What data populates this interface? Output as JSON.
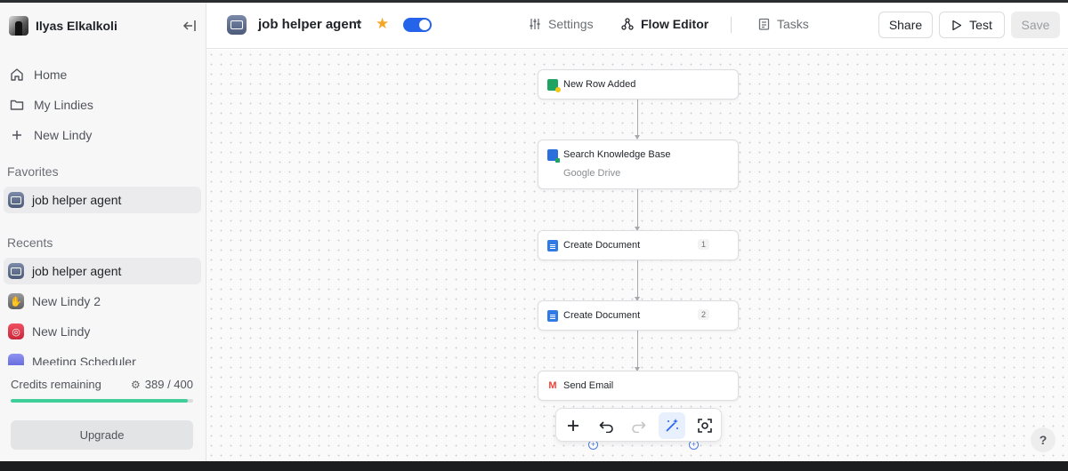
{
  "user": {
    "name": "Ilyas Elkalkoli"
  },
  "sidebar": {
    "nav": [
      {
        "label": "Home",
        "icon": "home-icon"
      },
      {
        "label": "My Lindies",
        "icon": "folder-icon"
      },
      {
        "label": "New Lindy",
        "icon": "plus-icon"
      }
    ],
    "favorites_label": "Favorites",
    "favorites": [
      {
        "label": "job helper agent",
        "icon": "robot-icon"
      }
    ],
    "recents_label": "Recents",
    "recents": [
      {
        "label": "job helper agent",
        "icon": "robot-icon"
      },
      {
        "label": "New Lindy 2",
        "icon": "hand-icon"
      },
      {
        "label": "New Lindy",
        "icon": "fingerprint-icon"
      },
      {
        "label": "Meeting Scheduler",
        "icon": "calendar-icon"
      }
    ],
    "credits": {
      "label": "Credits remaining",
      "value": "389 / 400",
      "used_fraction": 0.9725
    },
    "upgrade_label": "Upgrade"
  },
  "header": {
    "agent_name": "job helper agent",
    "favorite": true,
    "enabled": true,
    "tabs": [
      {
        "label": "Settings",
        "icon": "sliders-icon"
      },
      {
        "label": "Flow Editor",
        "icon": "flow-icon"
      },
      {
        "label": "Tasks",
        "icon": "clipboard-icon"
      }
    ],
    "share_label": "Share",
    "test_label": "Test",
    "save_label": "Save"
  },
  "flow": {
    "nodes": [
      {
        "title": "New Row Added",
        "subtitle": "",
        "step": "",
        "icon": "google-sheets-icon"
      },
      {
        "title": "Search Knowledge Base",
        "subtitle": "Google Drive",
        "step": "",
        "icon": "knowledge-base-icon"
      },
      {
        "title": "Create Document",
        "subtitle": "",
        "step": "1",
        "icon": "google-docs-icon"
      },
      {
        "title": "Create Document",
        "subtitle": "",
        "step": "2",
        "icon": "google-docs-icon"
      },
      {
        "title": "Send Email",
        "subtitle": "",
        "step": "",
        "icon": "gmail-icon"
      }
    ]
  },
  "colors": {
    "accent": "#2563eb",
    "credits_bar": "#3ecf9a",
    "star": "#f5a623"
  },
  "help_label": "?"
}
